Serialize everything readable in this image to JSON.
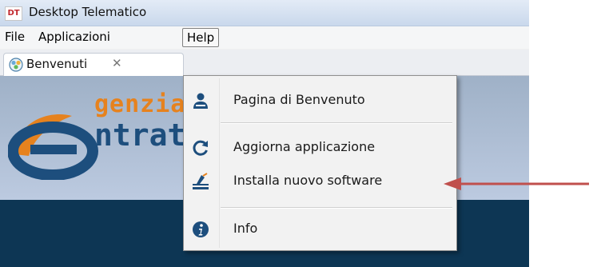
{
  "window": {
    "title": "Desktop Telematico",
    "app_icon_text": "DT"
  },
  "menubar": {
    "items": [
      {
        "label": "File"
      },
      {
        "label": "Applicazioni"
      },
      {
        "label": "Help"
      }
    ]
  },
  "tabs": [
    {
      "label": "Benvenuti",
      "close_glyph": "✕"
    }
  ],
  "banner": {
    "logo_line1": "genzia",
    "logo_line2": "ntrate",
    "brand_colors": {
      "orange": "#e6821e",
      "blue": "#1d4e7d",
      "dark_band": "#0d3654"
    }
  },
  "help_menu": {
    "items": [
      {
        "label": "Pagina di Benvenuto",
        "icon": "user-icon"
      },
      {
        "label": "Aggiorna  applicazione",
        "icon": "refresh-icon"
      },
      {
        "label": "Installa nuovo software",
        "icon": "install-icon"
      },
      {
        "label": "Info",
        "icon": "info-icon"
      }
    ]
  },
  "annotation": {
    "arrow_color": "#c0504d",
    "points_to": "Installa nuovo software"
  }
}
